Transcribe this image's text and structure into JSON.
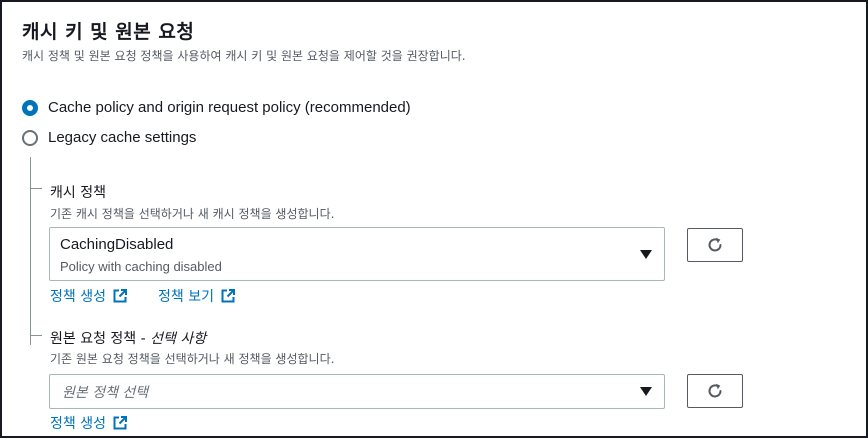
{
  "header": {
    "title": "캐시 키 및 원본 요청",
    "subtitle": "캐시 정책 및 원본 요청 정책을 사용하여 캐시 키 및 원본 요청을 제어할 것을 권장합니다."
  },
  "options": [
    {
      "label": "Cache policy and origin request policy (recommended)",
      "checked": true
    },
    {
      "label": "Legacy cache settings",
      "checked": false
    }
  ],
  "cache_policy": {
    "title": "캐시 정책",
    "description": "기존 캐시 정책을 선택하거나 새 캐시 정책을 생성합니다.",
    "selected_value": "CachingDisabled",
    "selected_description": "Policy with caching disabled",
    "create_link": "정책 생성",
    "view_link": "정책 보기"
  },
  "origin_request_policy": {
    "title": "원본 요청 정책 -",
    "title_optional": "선택 사항",
    "description": "기존 원본 요청 정책을 선택하거나 새 정책을 생성합니다.",
    "placeholder": "원본 정책 선택",
    "create_link": "정책 생성"
  },
  "icons": {
    "refresh": "refresh-icon",
    "external_link": "external-link-icon",
    "dropdown": "caret-down-icon"
  },
  "colors": {
    "accent": "#0073bb",
    "text": "#16191f",
    "muted": "#545b64",
    "border": "#aab7b8"
  }
}
